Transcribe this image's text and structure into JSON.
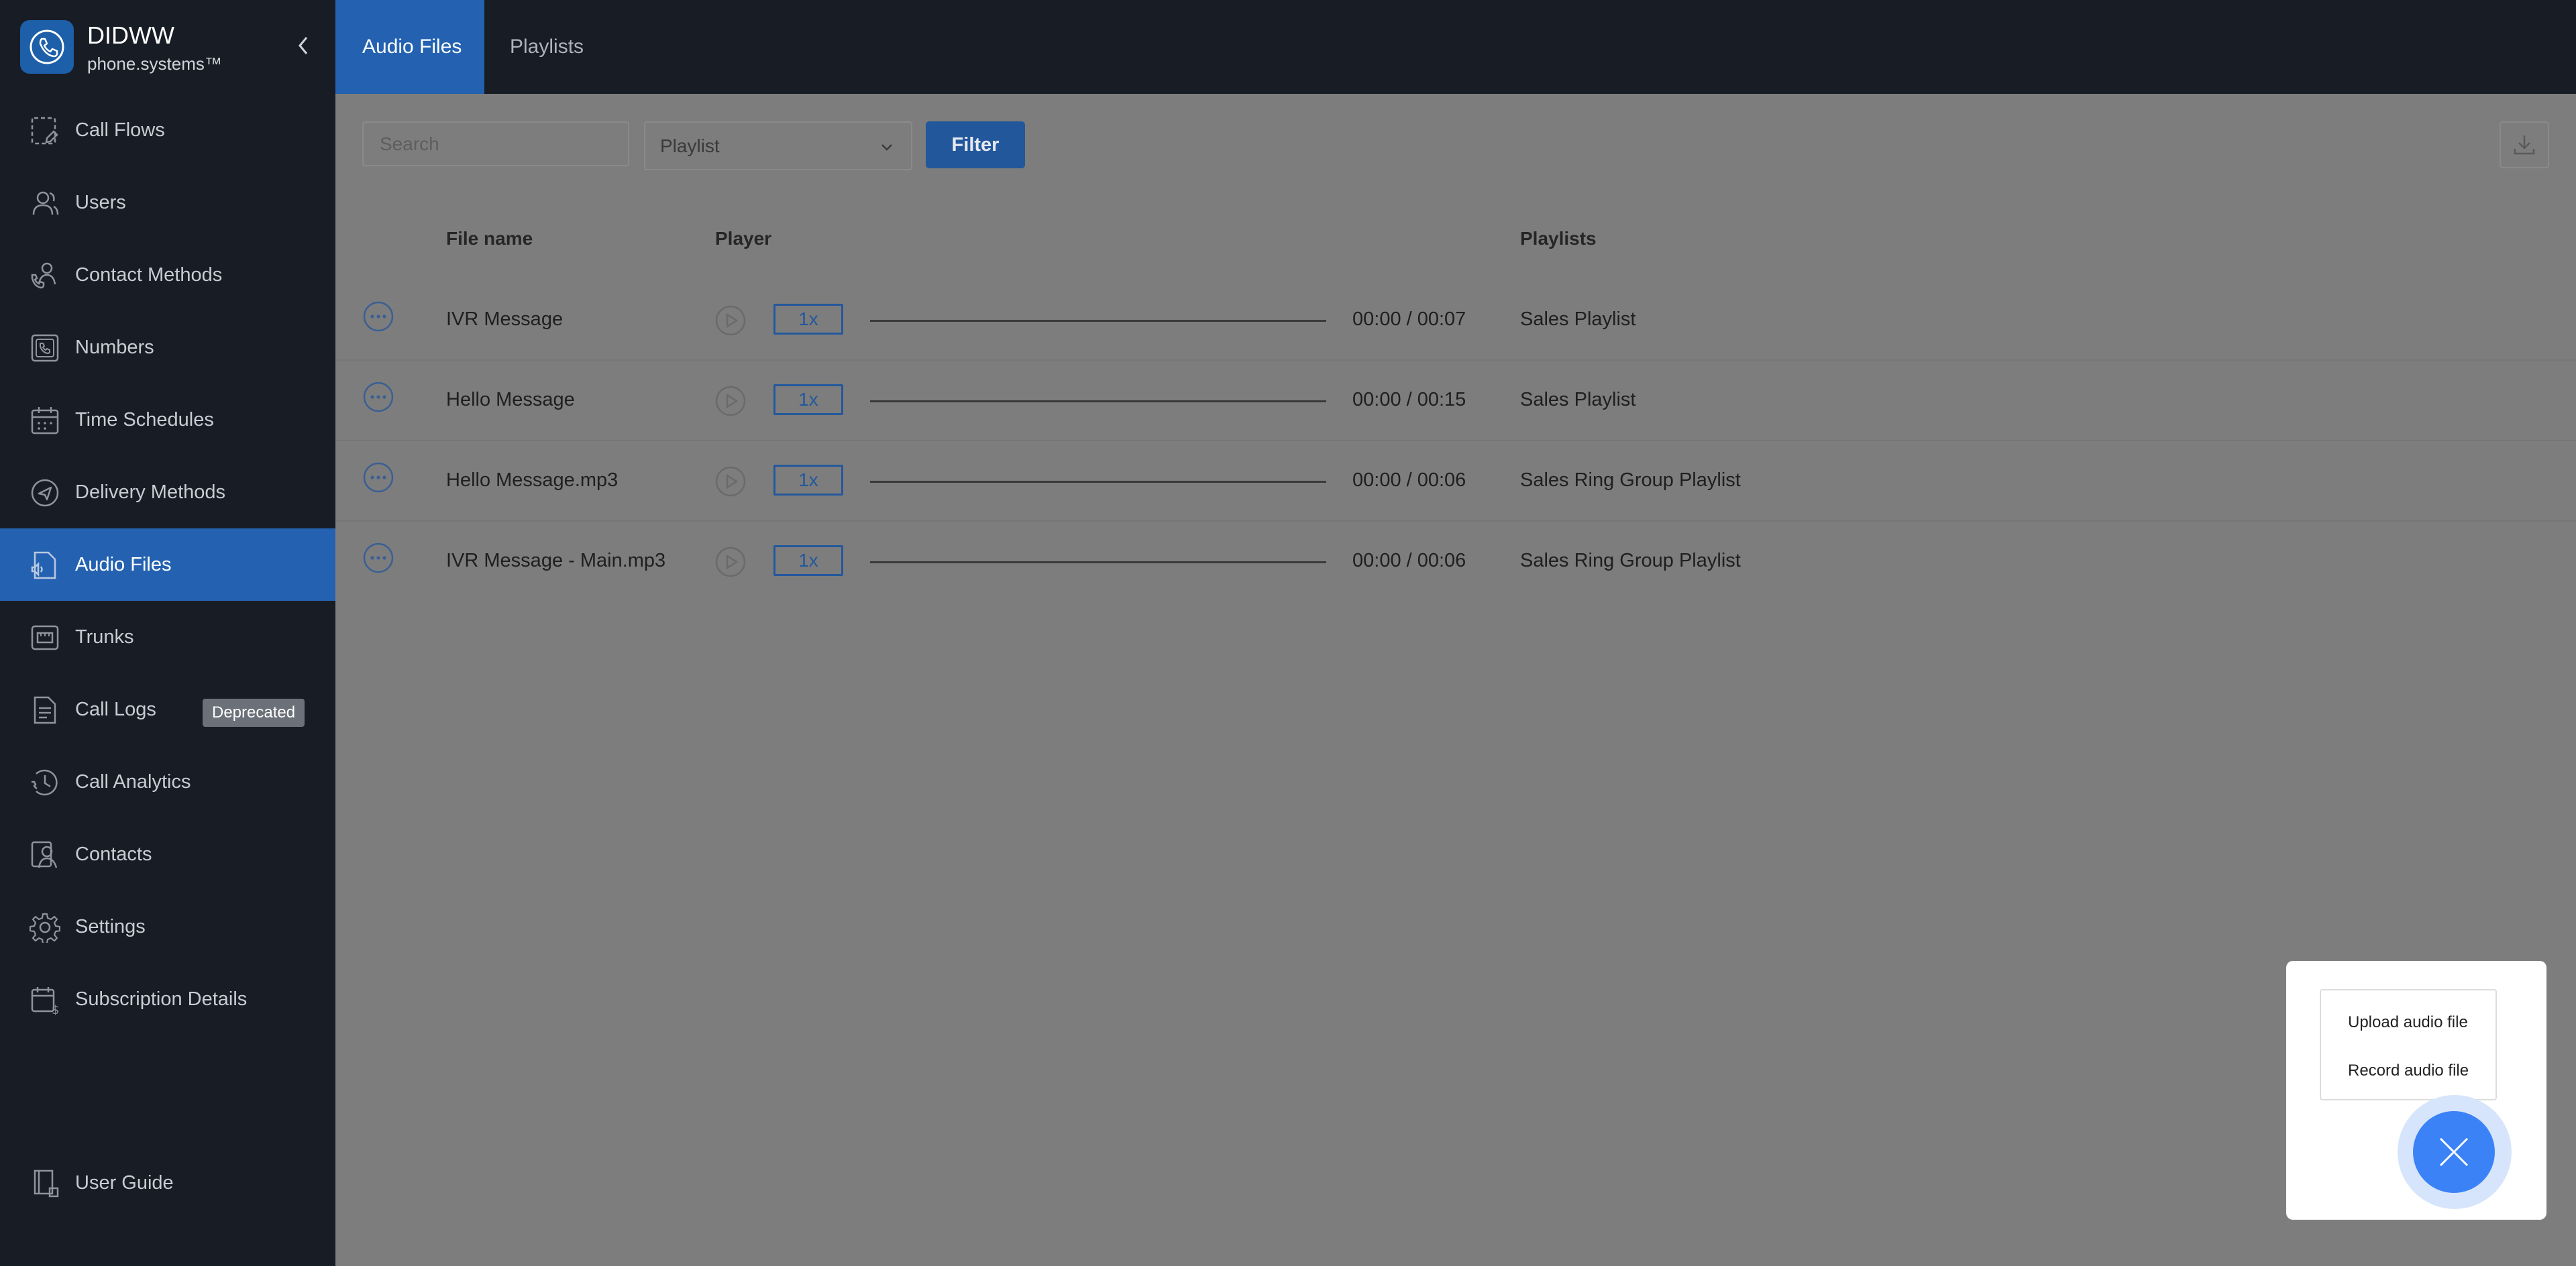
{
  "brand": {
    "name": "DIDWW",
    "subtitle": "phone.systems™"
  },
  "sidebar": {
    "items": [
      {
        "label": "Call Flows",
        "icon": "call-flows-icon"
      },
      {
        "label": "Users",
        "icon": "users-icon"
      },
      {
        "label": "Contact Methods",
        "icon": "contact-methods-icon"
      },
      {
        "label": "Numbers",
        "icon": "numbers-icon"
      },
      {
        "label": "Time Schedules",
        "icon": "calendar-icon"
      },
      {
        "label": "Delivery Methods",
        "icon": "send-icon"
      },
      {
        "label": "Audio Files",
        "icon": "audio-file-icon",
        "active": true
      },
      {
        "label": "Trunks",
        "icon": "trunk-icon"
      },
      {
        "label": "Call Logs",
        "icon": "document-icon",
        "badge": "Deprecated"
      },
      {
        "label": "Call Analytics",
        "icon": "analytics-icon"
      },
      {
        "label": "Contacts",
        "icon": "contacts-icon"
      },
      {
        "label": "Settings",
        "icon": "gear-icon"
      },
      {
        "label": "Subscription Details",
        "icon": "subscription-icon"
      }
    ],
    "guide": "User Guide"
  },
  "tabs": [
    {
      "label": "Audio Files",
      "active": true
    },
    {
      "label": "Playlists",
      "active": false
    }
  ],
  "filters": {
    "search_placeholder": "Search",
    "playlist_placeholder": "Playlist",
    "filter_label": "Filter"
  },
  "table": {
    "headers": {
      "file_name": "File name",
      "player": "Player",
      "playlists": "Playlists"
    },
    "rows": [
      {
        "file_name": "IVR Message",
        "speed": "1x",
        "time": "00:00 / 00:07",
        "playlist": "Sales Playlist"
      },
      {
        "file_name": "Hello Message",
        "speed": "1x",
        "time": "00:00 / 00:15",
        "playlist": "Sales Playlist"
      },
      {
        "file_name": "Hello Message.mp3",
        "speed": "1x",
        "time": "00:00 / 00:06",
        "playlist": "Sales Ring Group Playlist"
      },
      {
        "file_name": "IVR Message - Main.mp3",
        "speed": "1x",
        "time": "00:00 / 00:06",
        "playlist": "Sales Ring Group Playlist"
      }
    ]
  },
  "fab_menu": {
    "upload": "Upload audio file",
    "record": "Record audio file"
  },
  "colors": {
    "sidebar_bg": "#181c25",
    "accent": "#2462b1",
    "overlay": "#7d7d7d",
    "fab": "#3b82f6"
  }
}
